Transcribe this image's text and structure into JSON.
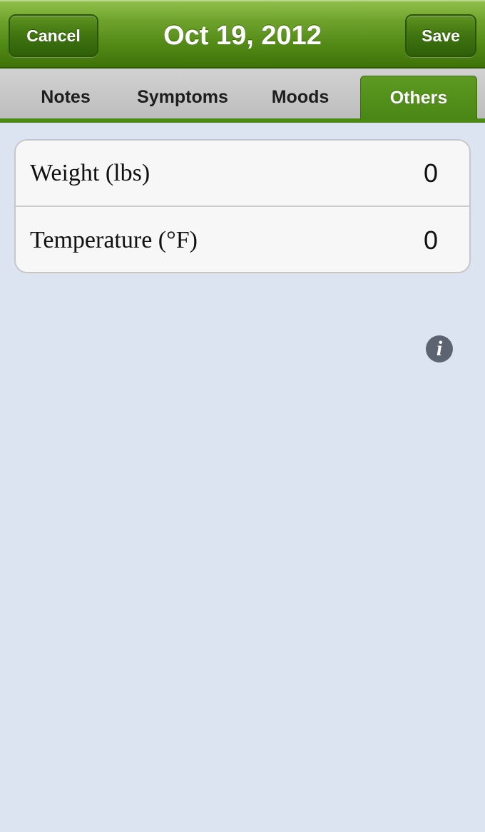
{
  "nav": {
    "title": "Oct 19, 2012",
    "cancel_label": "Cancel",
    "save_label": "Save"
  },
  "tabs": [
    {
      "label": "Notes",
      "active": false
    },
    {
      "label": "Symptoms",
      "active": false
    },
    {
      "label": "Moods",
      "active": false
    },
    {
      "label": "Others",
      "active": true
    }
  ],
  "fields": [
    {
      "label": "Weight (lbs)",
      "value": "0"
    },
    {
      "label": "Temperature (°F)",
      "value": "0"
    }
  ],
  "icons": {
    "info": "info-icon"
  },
  "colors": {
    "nav_green": "#4f8714",
    "tab_active": "#5d9a22",
    "background": "#dce3f1"
  }
}
